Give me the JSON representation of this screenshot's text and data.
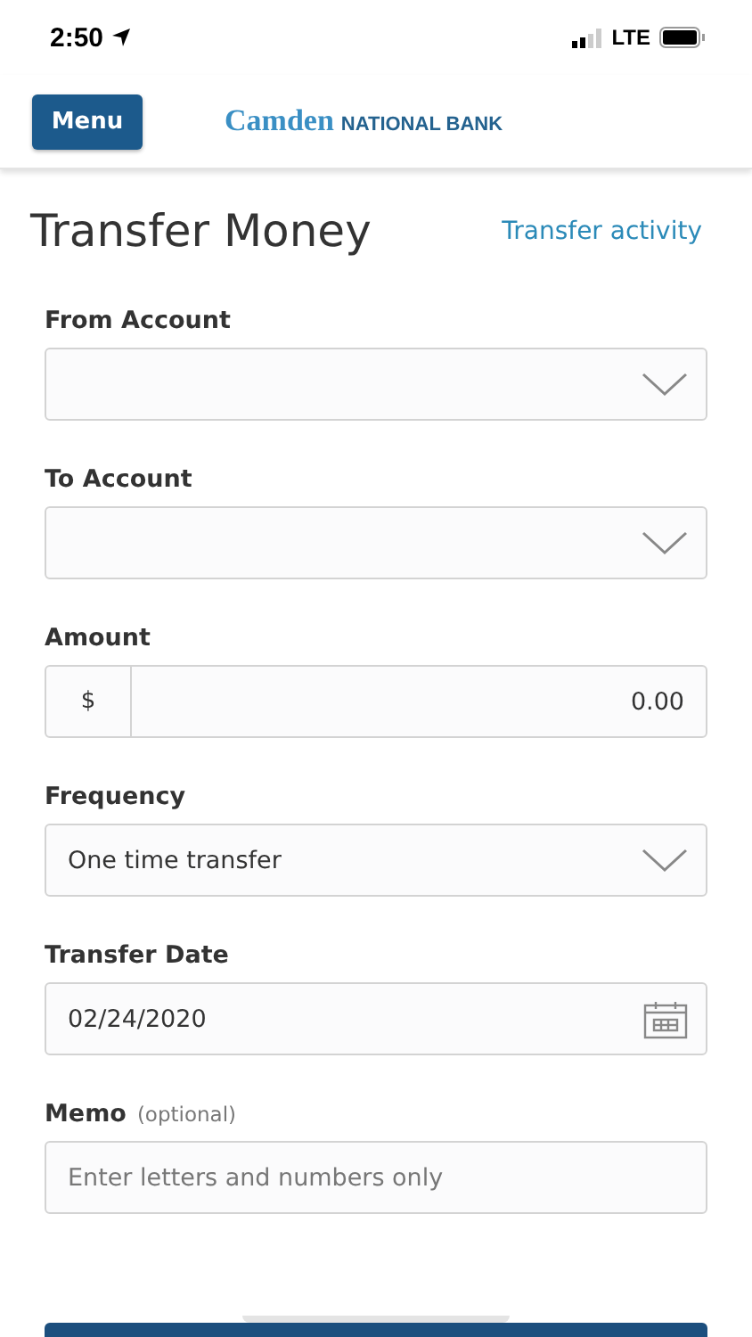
{
  "status_bar": {
    "time": "2:50",
    "network": "LTE"
  },
  "header": {
    "menu_button": "Menu",
    "logo_script": "Camden",
    "logo_caps": "NATIONAL BANK"
  },
  "page": {
    "title": "Transfer Money",
    "link": "Transfer activity"
  },
  "fields": [
    {
      "kind": "select",
      "label": "From Account"
    },
    {
      "kind": "select",
      "label": "To Account"
    },
    {
      "kind": "amount",
      "label": "Amount",
      "prefix": "$",
      "value": "0.00"
    },
    {
      "kind": "select",
      "label": "Frequency",
      "value": "One time transfer"
    },
    {
      "kind": "date",
      "label": "Transfer Date",
      "value": "02/24/2020"
    },
    {
      "kind": "text",
      "label": "Memo",
      "hint": "(optional)",
      "placeholder": "Enter letters and numbers only"
    }
  ]
}
